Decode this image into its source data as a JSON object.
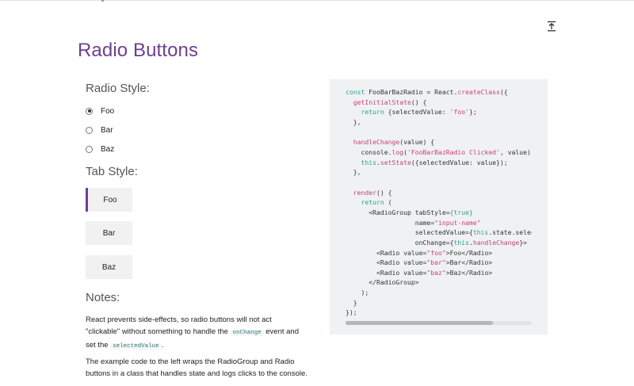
{
  "page": {
    "title": "Radio Buttons",
    "radio_style_heading": "Radio Style:",
    "tab_style_heading": "Tab Style:",
    "notes_heading": "Notes:"
  },
  "radio_group": {
    "options": [
      {
        "label": "Foo",
        "checked": true
      },
      {
        "label": "Bar",
        "checked": false
      },
      {
        "label": "Baz",
        "checked": false
      }
    ]
  },
  "tab_group": {
    "options": [
      {
        "label": "Foo",
        "active": true
      },
      {
        "label": "Bar",
        "active": false
      },
      {
        "label": "Baz",
        "active": false
      }
    ]
  },
  "notes": {
    "p1_a": "React prevents side-effects, so radio buttons will not act \"clickable\" without something to handle the",
    "p1_code1": "onChange",
    "p1_b": "event and set the",
    "p1_code2": "selectedValue",
    "p1_c": ".",
    "p2": "The example code to the left wraps the RadioGroup and Radio buttons in a class that handles state and logs clicks to the console."
  },
  "code": {
    "lines": [
      "const FooBarBazRadio = React.createClass({",
      "  getInitialState() {",
      "    return {selectedValue: 'foo'};",
      "  },",
      "",
      "  handleChange(value) {",
      "    console.log('FooBarBazRadio Clicked', value);",
      "    this.setState({selectedValue: value});",
      "  },",
      "",
      "  render() {",
      "    return (",
      "      <RadioGroup tabStyle={true}",
      "                  name=\"input-name\"",
      "                  selectedValue={this.state.selectedValue}",
      "                  onChange={this.handleChange}>",
      "        <Radio value=\"foo\">Foo</Radio>",
      "        <Radio value=\"bar\">Bar</Radio>",
      "        <Radio value=\"baz\">Baz</Radio>",
      "      </RadioGroup>",
      "    );",
      "  }",
      "});"
    ],
    "scroll_fraction": 0.79
  },
  "icons": {
    "collapse": "collapse-to-top-icon"
  },
  "colors": {
    "accent": "#6e3f8f",
    "code_keyword": "#2aa198",
    "code_string": "#d23d76",
    "code_bg": "#f0f1f2"
  }
}
